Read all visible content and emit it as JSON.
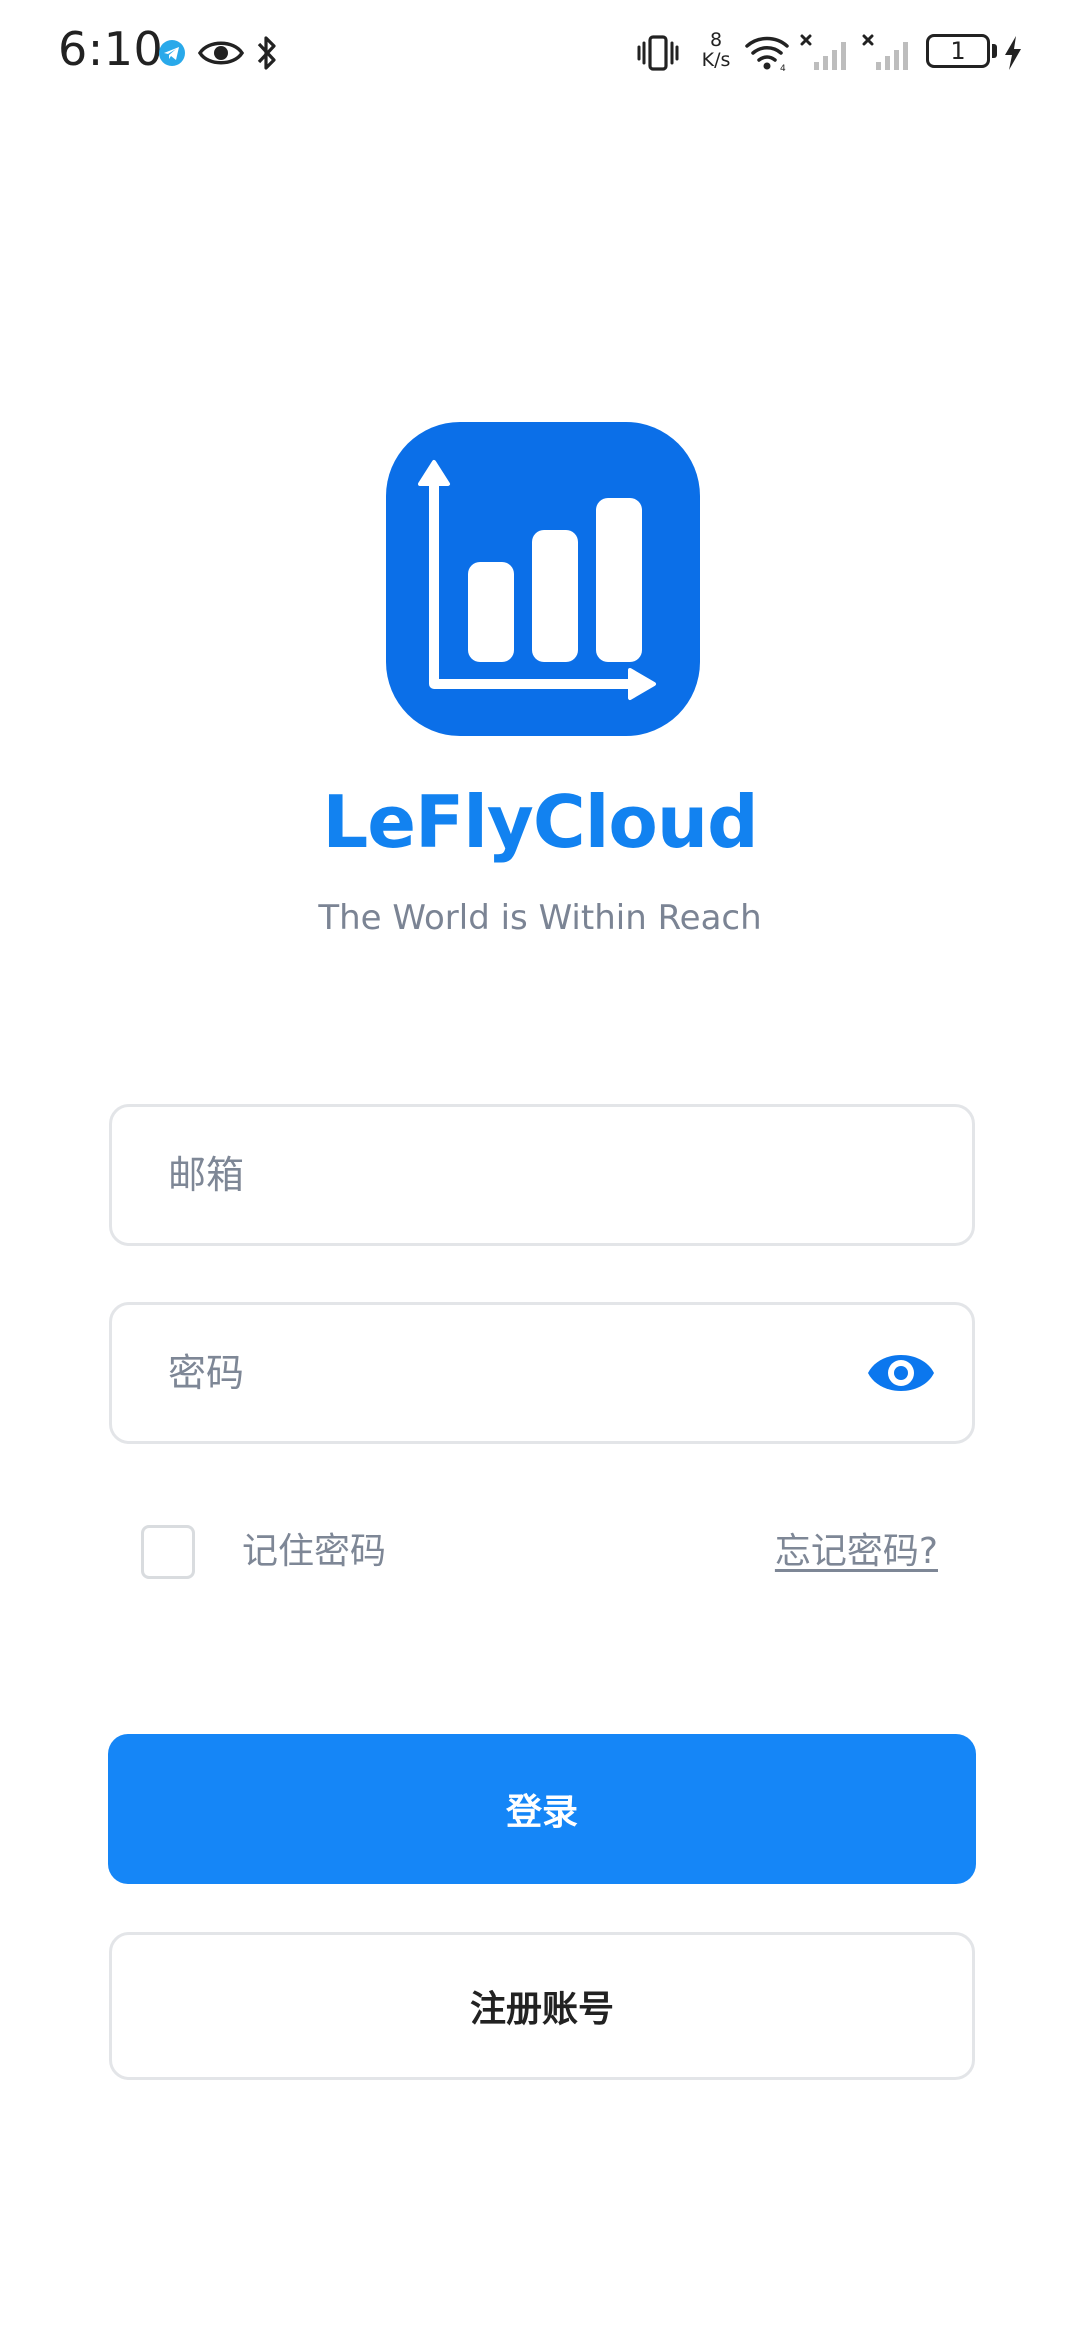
{
  "status_bar": {
    "time": "6:10",
    "net_speed_value": "8",
    "net_speed_unit": "K/s",
    "battery_level": "1",
    "icons": [
      "telegram-icon",
      "eye-icon",
      "bluetooth-icon",
      "vibrate-icon",
      "wifi-icon",
      "signal-icon",
      "signal-icon",
      "battery-icon",
      "charging-icon"
    ]
  },
  "app": {
    "name": "LeFlyCloud",
    "slogan": "The World is Within Reach",
    "logo_icon": "bar-chart-icon"
  },
  "form": {
    "email_placeholder": "邮箱",
    "email_value": "",
    "password_placeholder": "密码",
    "password_value": "",
    "password_toggle_icon": "eye-icon",
    "remember_label": "记住密码",
    "remember_checked": false,
    "forgot_label": "忘记密码?"
  },
  "actions": {
    "login_label": "登录",
    "register_label": "注册账号"
  },
  "colors": {
    "brand": "#1586f7",
    "logo_bg": "#0b6fe8",
    "title": "#1282f0",
    "muted_text": "#7e8796",
    "border": "#e3e5e8"
  }
}
